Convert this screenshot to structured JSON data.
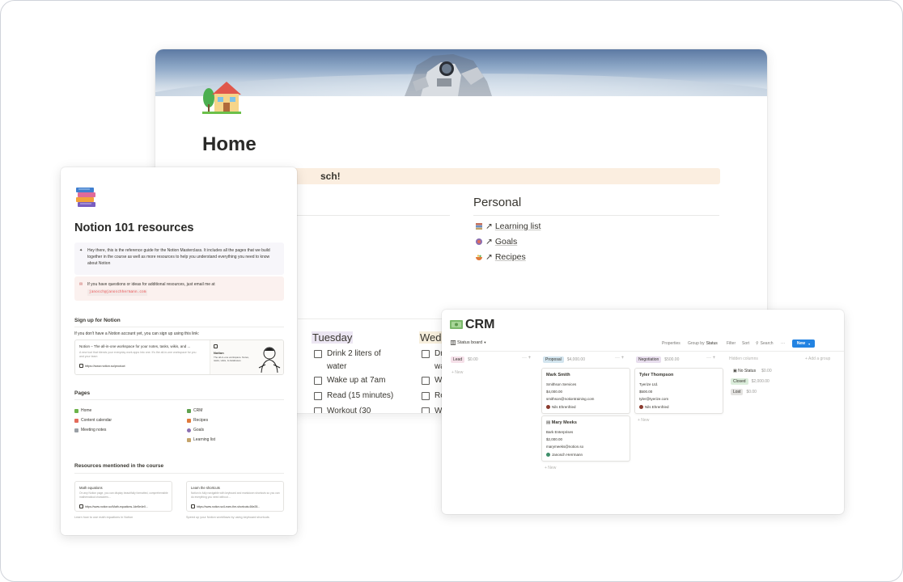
{
  "home": {
    "title": "Home",
    "callout_text": "sch!",
    "personal": {
      "heading": "Personal",
      "links": [
        {
          "arrow": "↗",
          "label": "Learning list",
          "color": "#c4a46b"
        },
        {
          "arrow": "↗",
          "label": "Goals",
          "color": "#8b6fb1"
        },
        {
          "arrow": "↗",
          "label": "Recipes",
          "color": "#e07a3b"
        }
      ]
    },
    "habits": {
      "tuesday": "Tuesday",
      "wednesday": "Wedn",
      "tuesday_items": [
        "Drink 2 liters of",
        "water",
        "Wake up at 7am",
        "Read (15 minutes)",
        "Workout (30"
      ],
      "wednesday_items": [
        "Dr",
        "wa",
        "Wa",
        "Re",
        "Wo"
      ]
    }
  },
  "resources": {
    "title": "Notion 101 resources",
    "callout1": "Hey there, this is the reference guide for the Notion Masterclass. It includes all the pages that we build together in the course as well as more resources to help you understand everything you need to know about Notion",
    "callout2": "If you have questions or ideas for additional resources, just email me at",
    "email": "janosch@janoschhermann.com",
    "signup_heading": "Sign up for Notion",
    "signup_text": "If you don't have a Notion account yet, you can sign up using this link:",
    "bookmark": {
      "title": "Notion – The all-in-one workspace for your notes, tasks, wikis, and ...",
      "desc": "A new tool that blends your everyday work apps into one. It's the all-in-one workspace for you and your team",
      "url": "https://www.notion.so/product",
      "img_title": "Notion",
      "img_sub": "The all-in-one workspace. Notes, tasks, wikis, & databases."
    },
    "pages_heading": "Pages",
    "pages_left": [
      "Home",
      "Content calendar",
      "Meeting notes"
    ],
    "pages_right": [
      "CRM",
      "Recipes",
      "Goals",
      "Learning list"
    ],
    "mentioned_heading": "Resources mentioned in the course",
    "cards": [
      {
        "title": "Math equations",
        "desc": "On any Notion page, you can display beautifully formatted, comprehensible mathematical characters...",
        "url": "https://www.notion.so/Math-equations-1de5e4e0...",
        "caption": "Learn how to use math equations in Notion"
      },
      {
        "title": "Learn the shortcuts",
        "desc": "Notion is fully navigable with keyboard and markdown shortcuts so you can do everything you need without ...",
        "url": "https://www.notion.so/Learn-the-shortcuts-66e28...",
        "caption": "Speed up your Notion workflows by using keyboard shortcuts"
      }
    ]
  },
  "crm": {
    "title": "CRM",
    "view_tab": "Status board",
    "toolbar": {
      "properties": "Properties",
      "group_by": "Group by",
      "group_value": "Status",
      "filter": "Filter",
      "sort": "Sort",
      "search": "Search",
      "more": "···",
      "new": "New"
    },
    "columns": [
      {
        "name": "Lead",
        "sum": "$0.00",
        "color": "#f5e0e9"
      },
      {
        "name": "Proposal",
        "sum": "$4,000.00",
        "color": "#d3e5ef"
      },
      {
        "name": "Negotiation",
        "sum": "$500.00",
        "color": "#e8deee"
      }
    ],
    "add_new": "+ New",
    "cards": [
      {
        "name": "Mark Smith",
        "company": "Smithson Services",
        "value": "$4,000.00",
        "email": "smithson@notiontraining.com",
        "owner": "Nils Ehrenfried"
      },
      {
        "name": "Mary Meeks",
        "company": "Bark Enterprises",
        "value": "$2,000.00",
        "email": "marymeeks@notion.so",
        "owner": "Janosch Herrmann"
      },
      {
        "name": "Tyler Thompson",
        "company": "Tyerize Ltd.",
        "value": "$500.00",
        "email": "tyler@tyerize.com",
        "owner": "Nils Ehrenfried"
      }
    ],
    "hidden_heading": "Hidden columns",
    "add_group": "+ Add a group",
    "hidden": [
      {
        "name": "No Status",
        "sum": "$0.00",
        "color": "#ffffff"
      },
      {
        "name": "Closed",
        "sum": "$2,000.00",
        "color": "#dbeddb"
      },
      {
        "name": "Lost",
        "sum": "$0.00",
        "color": "#e3e2e0"
      }
    ]
  }
}
